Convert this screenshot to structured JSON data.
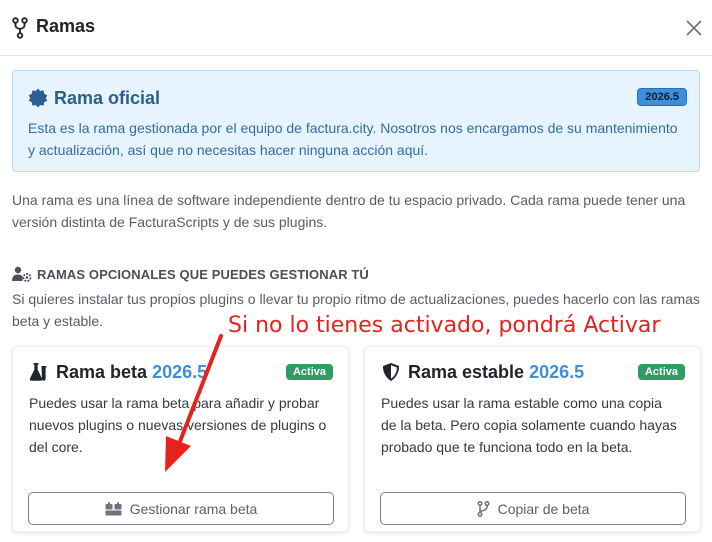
{
  "header": {
    "title": "Ramas",
    "icon": "git-branch-icon",
    "close_icon": "close-icon"
  },
  "official": {
    "title": "Rama oficial",
    "icon": "certificate-badge-icon",
    "version": "2026.5",
    "description": "Esta es la rama gestionada por el equipo de factura.city. Nosotros nos encargamos de su mantenimiento y actualización, así que no necesitas hacer ninguna acción aquí."
  },
  "intro": "Una rama es una línea de software independiente dentro de tu espacio privado. Cada rama puede tener una versión distinta de FacturaScripts y de sus plugins.",
  "optional": {
    "heading": "RAMAS OPCIONALES QUE PUEDES GESTIONAR TÚ",
    "icon": "user-gear-icon",
    "description": "Si quieres instalar tus propios plugins o llevar tu propio ritmo de actualizaciones, puedes hacerlo con las ramas beta y estable."
  },
  "annotation": "Si no lo tienes activado, pondrá Activar",
  "cards": {
    "beta": {
      "title": "Rama beta",
      "version": "2026.5",
      "badge": "Activa",
      "icon": "flask-icon",
      "description": "Puedes usar la rama beta para añadir y probar nuevos plugins o nuevas versiones de plugins o del core.",
      "button": "Gestionar rama beta",
      "button_icon": "boxes-icon"
    },
    "stable": {
      "title": "Rama estable",
      "version": "2026.5",
      "badge": "Activa",
      "icon": "shield-icon",
      "description": "Puedes usar la rama estable como una copia de la beta. Pero copia solamente cuando hayas probado que te funciona todo en la beta.",
      "button": "Copiar de beta",
      "button_icon": "git-branch-icon"
    }
  },
  "colors": {
    "accent": "#3d8fdc",
    "success": "#2f9d62",
    "annotation": "#e5231c",
    "info_bg": "#e7f3fd"
  }
}
